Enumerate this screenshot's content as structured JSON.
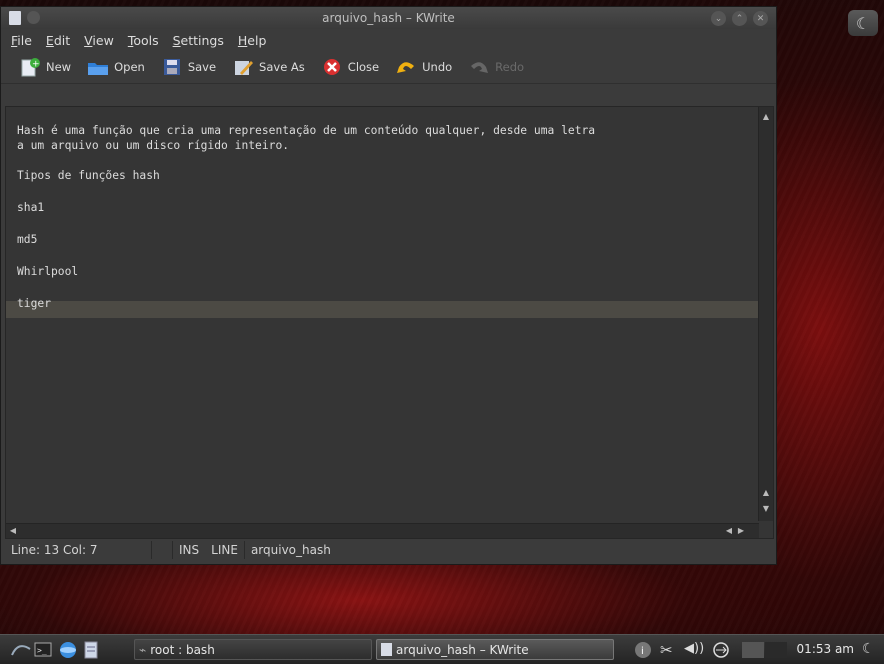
{
  "window": {
    "title": "arquivo_hash – KWrite"
  },
  "menubar": {
    "items": [
      {
        "label": "File",
        "u": "F",
        "rest": "ile"
      },
      {
        "label": "Edit",
        "u": "E",
        "rest": "dit"
      },
      {
        "label": "View",
        "u": "V",
        "rest": "iew"
      },
      {
        "label": "Tools",
        "u": "T",
        "rest": "ools"
      },
      {
        "label": "Settings",
        "u": "S",
        "rest": "ettings"
      },
      {
        "label": "Help",
        "u": "H",
        "rest": "elp"
      }
    ]
  },
  "toolbar": {
    "new_label": "New",
    "open_label": "Open",
    "save_label": "Save",
    "saveas_label": "Save As",
    "close_label": "Close",
    "undo_label": "Undo",
    "redo_label": "Redo"
  },
  "editor": {
    "lines": [
      "Hash é uma função que cria uma representação de um conteúdo qualquer, desde uma letra",
      "a um arquivo ou um disco rígido inteiro.",
      "",
      "Tipos de funções hash",
      "",
      "sha1",
      "",
      "md5",
      "",
      "Whirlpool",
      "",
      "tiger"
    ]
  },
  "statusbar": {
    "position": "Line: 13 Col: 7",
    "mode": "INS",
    "selection": "LINE",
    "filename": "arquivo_hash"
  },
  "taskbar": {
    "tasks": [
      {
        "label": "root : bash"
      },
      {
        "label": "arquivo_hash – KWrite"
      }
    ],
    "clock": "01:53 am"
  },
  "colors": {
    "accent_red": "#8c0f0f",
    "editor_bg": "#353535",
    "current_line": "#4c4a44"
  }
}
